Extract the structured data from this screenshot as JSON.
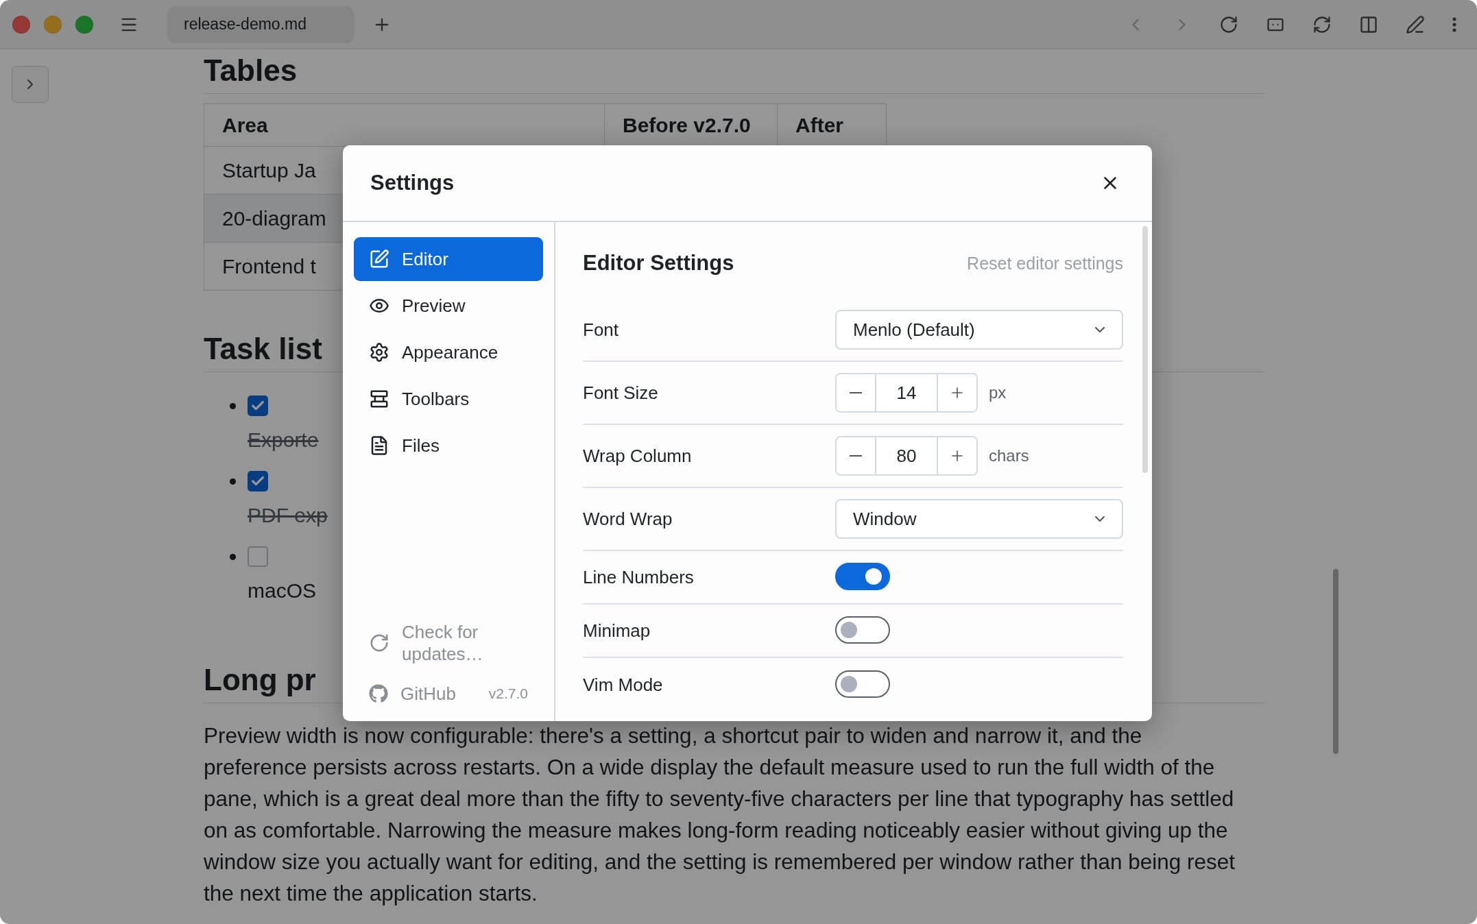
{
  "toolbar": {
    "tab_title": "release-demo.md"
  },
  "document": {
    "sections": [
      {
        "kind": "table",
        "heading": "Tables",
        "columns": [
          "Area",
          "Before v2.7.0",
          "After"
        ],
        "rows": [
          [
            "Startup Ja"
          ],
          [
            "20-diagram"
          ],
          [
            "Frontend t"
          ]
        ]
      },
      {
        "kind": "tasks",
        "heading": "Task list",
        "items": [
          {
            "text": "Exporte",
            "checked": true
          },
          {
            "text": "PDF exp",
            "checked": true
          },
          {
            "text": "macOS",
            "checked": false
          }
        ]
      },
      {
        "kind": "paragraph",
        "heading": "Long pr",
        "text": "Preview width is now configurable: there's a setting, a shortcut pair to widen and narrow it, and the preference persists across restarts. On a wide display the default measure used to run the full width of the pane, which is a great deal more than the fifty to seventy-five characters per line that typography has settled on as comfortable. Narrowing the measure makes long-form reading noticeably easier without giving up the window size you actually want for editing, and the setting is remembered per window rather than being reset the next time the application starts."
      }
    ]
  },
  "settings_dialog": {
    "title": "Settings",
    "nav": [
      {
        "kind": "edit",
        "label": "Editor",
        "selected": true
      },
      {
        "kind": "eye",
        "label": "Preview",
        "selected": false
      },
      {
        "kind": "gear",
        "label": "Appearance",
        "selected": false
      },
      {
        "kind": "toolbars",
        "label": "Toolbars",
        "selected": false
      },
      {
        "kind": "file",
        "label": "Files",
        "selected": false
      }
    ],
    "check_updates": "Check for updates…",
    "github": "GitHub",
    "version": "v2.7.0",
    "section_title": "Editor Settings",
    "reset": "Reset editor settings",
    "rows": [
      {
        "kind": "select",
        "label": "Font",
        "value": "Menlo (Default)"
      },
      {
        "kind": "stepper",
        "label": "Font Size",
        "value": "14",
        "unit": "px"
      },
      {
        "kind": "stepper",
        "label": "Wrap Column",
        "value": "80",
        "unit": "chars"
      },
      {
        "kind": "select",
        "label": "Word Wrap",
        "value": "Window"
      },
      {
        "kind": "toggle",
        "label": "Line Numbers",
        "on": true
      },
      {
        "kind": "toggle",
        "label": "Minimap",
        "on": false
      },
      {
        "kind": "toggle",
        "label": "Vim Mode",
        "on": false
      }
    ]
  }
}
